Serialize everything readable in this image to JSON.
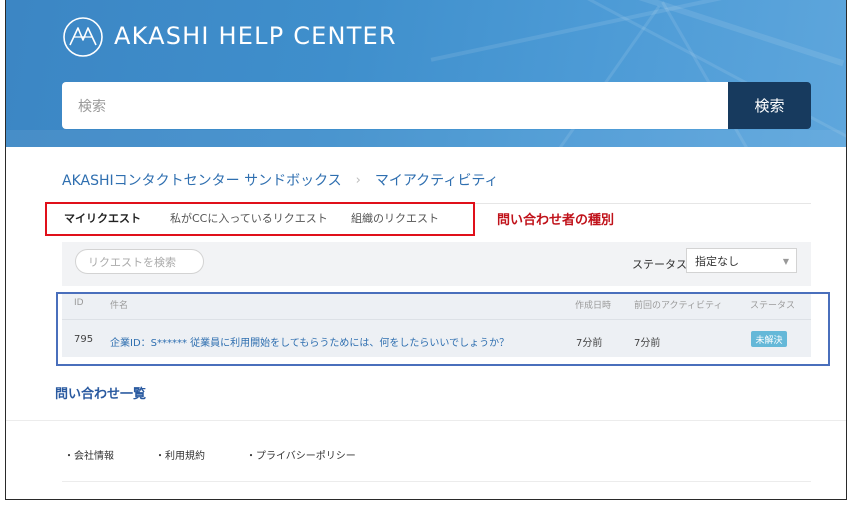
{
  "header": {
    "brand": "AKASHI HELP CENTER",
    "search_placeholder": "検索",
    "search_button": "検索"
  },
  "breadcrumb": {
    "items": [
      "AKASHIコンタクトセンター サンドボックス",
      "マイアクティビティ"
    ],
    "separator": "›"
  },
  "tabs": [
    {
      "label": "マイリクエスト",
      "active": true
    },
    {
      "label": "私がCCに入っているリクエスト",
      "active": false
    },
    {
      "label": "組織のリクエスト",
      "active": false
    }
  ],
  "annotations": {
    "tabs_label": "問い合わせ者の種別",
    "list_label": "問い合わせ一覧"
  },
  "filter": {
    "search_placeholder": "リクエストを検索",
    "status_label": "ステータス:",
    "status_value": "指定なし"
  },
  "table": {
    "headers": [
      "ID",
      "件名",
      "作成日時",
      "前回のアクティビティ",
      "ステータス"
    ],
    "rows": [
      {
        "id": "795",
        "subject": "企業ID：S****** 従業員に利用開始をしてもらうためには、何をしたらいいでしょうか？",
        "created": "7分前",
        "last_activity": "7分前",
        "status": "未解決"
      }
    ]
  },
  "footer": {
    "links": [
      "・会社情報",
      "・利用規約",
      "・プライバシーポリシー"
    ]
  },
  "colors": {
    "header_bg": "#3f8fcc",
    "search_button_bg": "#173a5e",
    "link": "#2f6fb0",
    "badge": "#65b8d8",
    "highlight_red": "#e0101a",
    "highlight_blue": "#4a6fbc"
  }
}
